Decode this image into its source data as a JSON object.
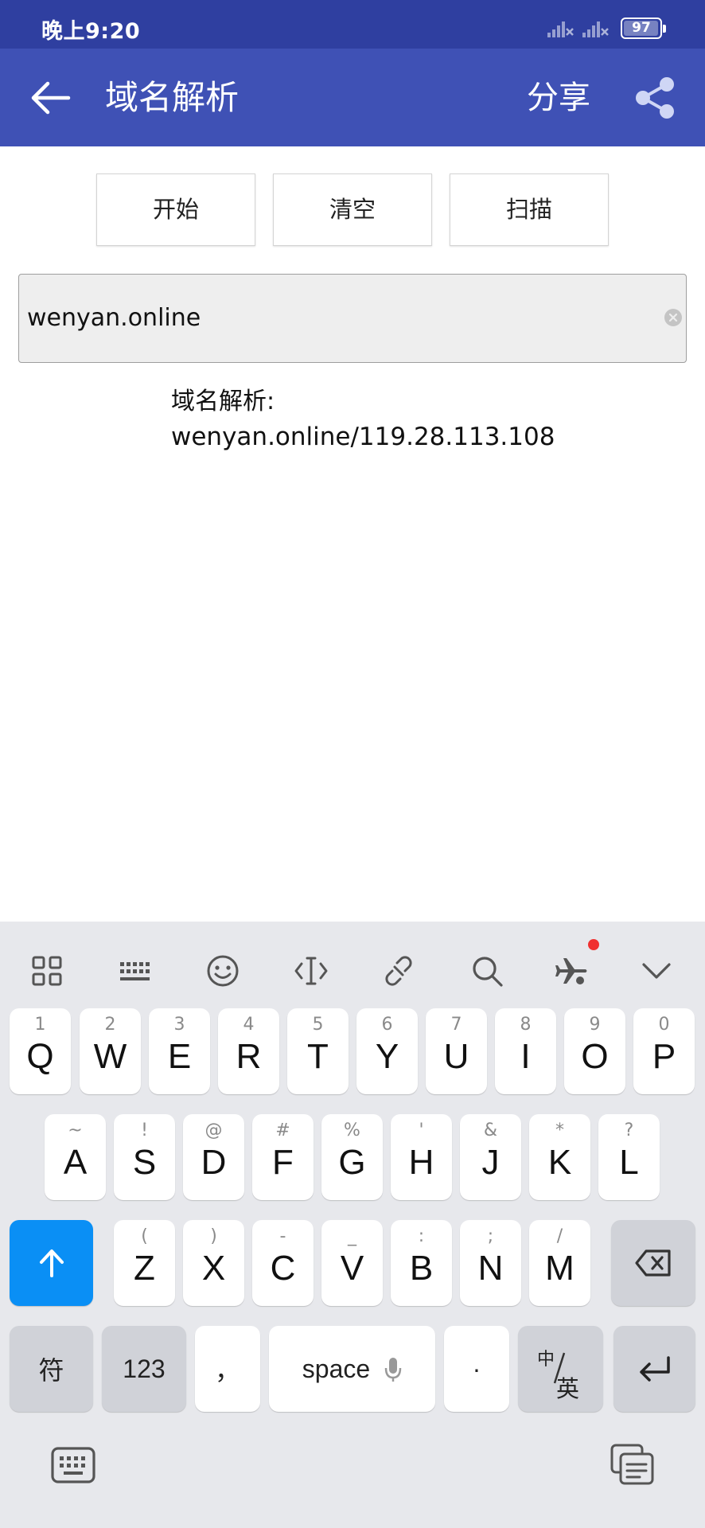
{
  "status_bar": {
    "time": "晚上9:20",
    "battery": "97",
    "battery_level": 0.97
  },
  "app_bar": {
    "title": "域名解析",
    "share_label": "分享"
  },
  "actions": {
    "start": "开始",
    "clear": "清空",
    "scan": "扫描"
  },
  "input": {
    "value": "wenyan.online"
  },
  "result": {
    "label": "域名解析:",
    "value": "wenyan.online/119.28.113.108"
  },
  "keyboard": {
    "row1": [
      {
        "key": "Q",
        "sub": "1"
      },
      {
        "key": "W",
        "sub": "2"
      },
      {
        "key": "E",
        "sub": "3"
      },
      {
        "key": "R",
        "sub": "4"
      },
      {
        "key": "T",
        "sub": "5"
      },
      {
        "key": "Y",
        "sub": "6"
      },
      {
        "key": "U",
        "sub": "7"
      },
      {
        "key": "I",
        "sub": "8"
      },
      {
        "key": "O",
        "sub": "9"
      },
      {
        "key": "P",
        "sub": "0"
      }
    ],
    "row2": [
      {
        "key": "A",
        "sub": "~"
      },
      {
        "key": "S",
        "sub": "!"
      },
      {
        "key": "D",
        "sub": "@"
      },
      {
        "key": "F",
        "sub": "#"
      },
      {
        "key": "G",
        "sub": "%"
      },
      {
        "key": "H",
        "sub": "'"
      },
      {
        "key": "J",
        "sub": "&"
      },
      {
        "key": "K",
        "sub": "*"
      },
      {
        "key": "L",
        "sub": "?"
      }
    ],
    "row3": [
      {
        "key": "Z",
        "sub": "("
      },
      {
        "key": "X",
        "sub": ")"
      },
      {
        "key": "C",
        "sub": "-"
      },
      {
        "key": "V",
        "sub": "_"
      },
      {
        "key": "B",
        "sub": ":"
      },
      {
        "key": "N",
        "sub": ";"
      },
      {
        "key": "M",
        "sub": "/"
      }
    ],
    "symbols": "符",
    "numbers": "123",
    "comma": "，",
    "space": "space",
    "period": "·",
    "lang_top": "中",
    "lang_bottom": "英"
  }
}
